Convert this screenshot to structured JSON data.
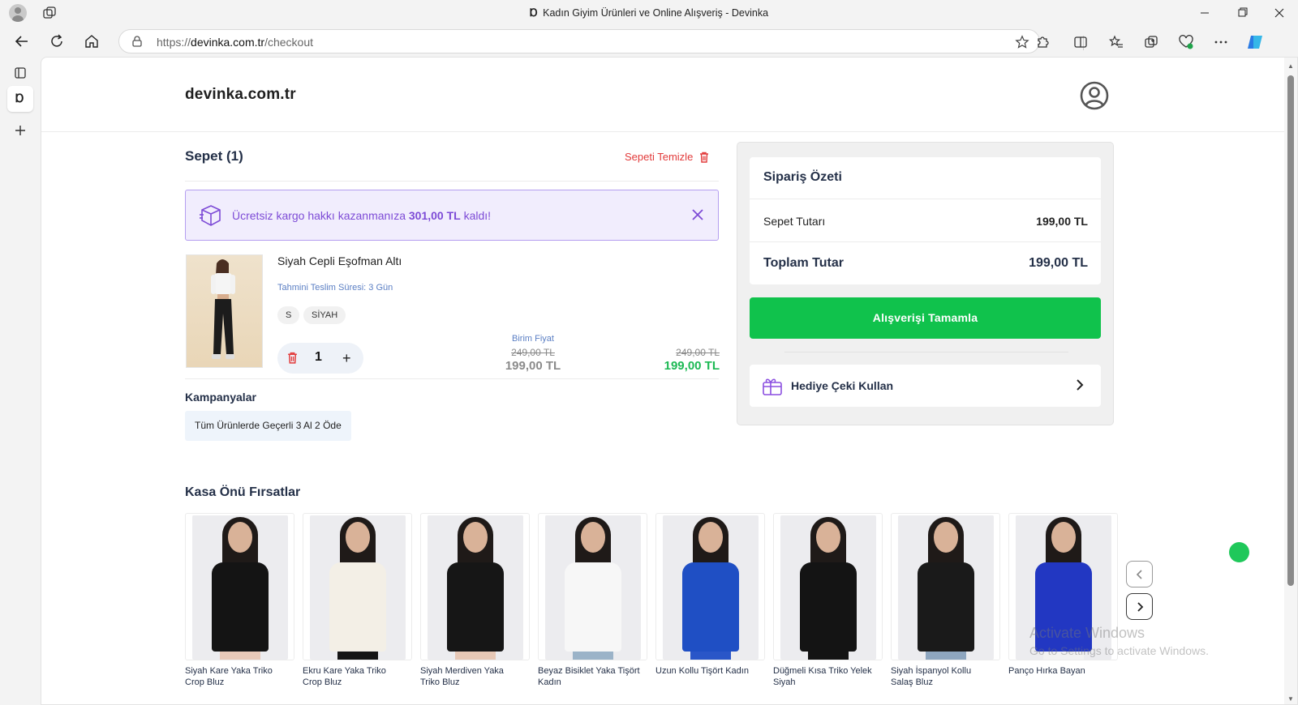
{
  "browser": {
    "window_title": "Kadın Giyim Ürünleri ve Online Alışveriş - Devinka",
    "favicon_glyph": "Ɒ",
    "url_prefix": "https://",
    "url_domain": "devinka.com.tr",
    "url_path": "/checkout",
    "icons": [
      "back-icon",
      "refresh-icon",
      "home-icon",
      "lock-icon",
      "star-icon",
      "extensions-icon",
      "split-screen-icon",
      "favorites-icon",
      "collections-icon",
      "performance-icon",
      "more-icon",
      "copilot-icon"
    ]
  },
  "site": {
    "logo": "devinka.com.tr"
  },
  "cart": {
    "title": "Sepet (1)",
    "clear_label": "Sepeti Temizle",
    "cargo_prefix": "Ücretsiz kargo hakkı kazanmanıza",
    "cargo_amount": "301,00 TL",
    "cargo_suffix": "kaldı!",
    "item": {
      "name": "Siyah Cepli Eşofman Altı",
      "delivery": "Tahmini Teslim Süresi: 3 Gün",
      "size": "S",
      "color": "SİYAH",
      "quantity": "1",
      "plus": "+",
      "unit_label": "Birim Fiyat",
      "unit_old": "249,00 TL",
      "unit_new": "199,00 TL",
      "total_old": "249,00 TL",
      "total_new": "199,00 TL"
    },
    "campaigns_title": "Kampanyalar",
    "campaign": "Tüm Ürünlerde Geçerli 3 Al 2 Öde"
  },
  "summary": {
    "title": "Sipariş Özeti",
    "subtotal_label": "Sepet Tutarı",
    "subtotal_value": "199,00 TL",
    "total_label": "Toplam Tutar",
    "total_value": "199,00 TL",
    "checkout_label": "Alışverişi Tamamla",
    "gift_label": "Hediye Çeki Kullan"
  },
  "deals": {
    "title": "Kasa Önü Fırsatlar",
    "products": [
      {
        "title": "Siyah Kare Yaka Triko Crop Bluz",
        "top_color": "#141414",
        "bottom_color": "#e8c9b8"
      },
      {
        "title": "Ekru Kare Yaka Triko Crop Bluz",
        "top_color": "#f3efe6",
        "bottom_color": "#151515"
      },
      {
        "title": "Siyah Merdiven Yaka Triko Bluz",
        "top_color": "#161616",
        "bottom_color": "#e7c8b6"
      },
      {
        "title": "Beyaz Bisiklet Yaka Tişört Kadın",
        "top_color": "#f7f7f7",
        "bottom_color": "#9bb3c8"
      },
      {
        "title": "Uzun Kollu Tişört Kadın",
        "top_color": "#1f4fc4",
        "bottom_color": "#2a56c8"
      },
      {
        "title": "Düğmeli Kısa Triko Yelek Siyah",
        "top_color": "#141414",
        "bottom_color": "#141414"
      },
      {
        "title": "Siyah İspanyol Kollu Salaş Bluz",
        "top_color": "#1a1a1a",
        "bottom_color": "#8ea6bf"
      },
      {
        "title": "Panço Hırka Bayan",
        "top_color": "#2237c2",
        "bottom_color": "#f2f2f2"
      }
    ]
  },
  "watermark": {
    "line1": "Activate Windows",
    "line2": "Go to Settings to activate Windows."
  },
  "colors": {
    "accent_green": "#10c24c",
    "danger_red": "#e23b3b",
    "purple": "#7d4bd6",
    "heading": "#243048"
  }
}
